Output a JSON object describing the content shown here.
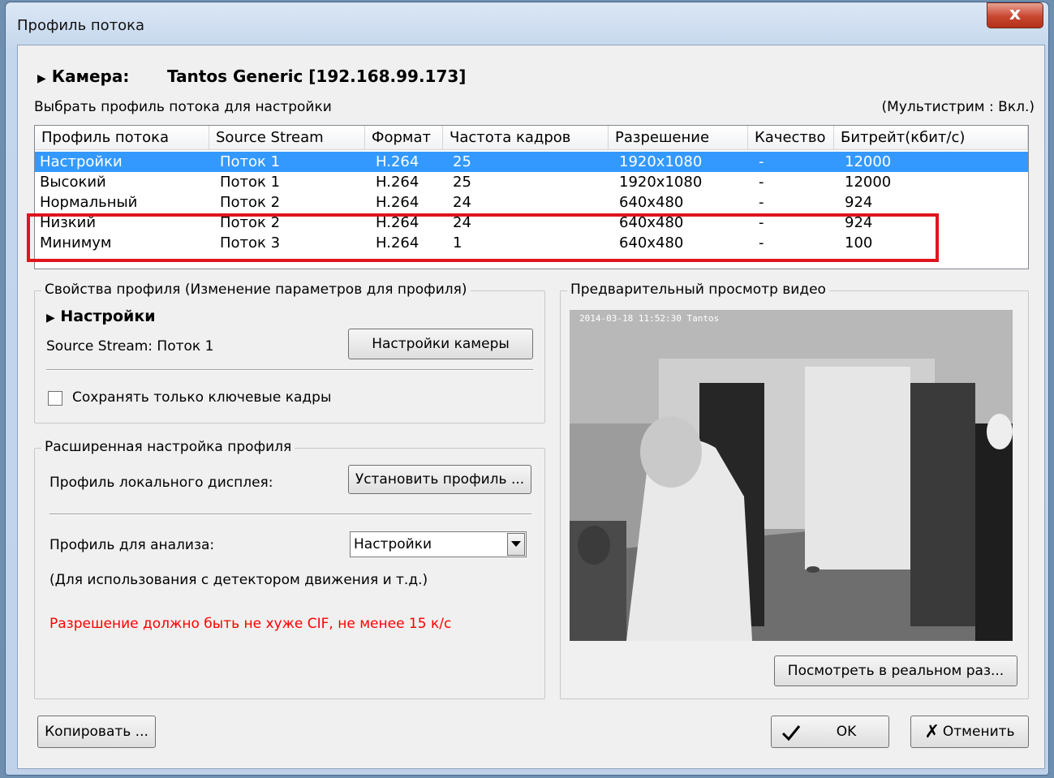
{
  "window": {
    "title": "Профиль потока",
    "close_glyph": "x"
  },
  "camera": {
    "label": "Камера:",
    "value": "Tantos Generic [192.168.99.173]"
  },
  "select_label": "Выбрать профиль потока для настройки",
  "multistream": "(Мультистрим : Вкл.)",
  "table": {
    "headers": [
      "Профиль потока",
      "Source Stream",
      "Формат",
      "Частота кадров",
      "Разрешение",
      "Качество",
      "Битрейт(кбит/с)"
    ],
    "rows": [
      [
        "Настройки",
        "Поток  1",
        "H.264",
        "25",
        "1920x1080",
        "-",
        "12000"
      ],
      [
        "Высокий",
        "Поток  1",
        "H.264",
        "25",
        "1920x1080",
        "-",
        "12000"
      ],
      [
        "Нормальный",
        "Поток  2",
        "H.264",
        "24",
        "640x480",
        "-",
        "924"
      ],
      [
        "Низкий",
        "Поток  2",
        "H.264",
        "24",
        "640x480",
        "-",
        "924"
      ],
      [
        "Минимум",
        "Поток  3",
        "H.264",
        "1",
        "640x480",
        "-",
        "100"
      ]
    ],
    "selected_index": 0
  },
  "props": {
    "title": "Свойства профиля (Изменение параметров для профиля)",
    "profile_name": "Настройки",
    "source_stream": "Source Stream: Поток  1",
    "camera_settings_button": "Настройки камеры",
    "keyframes_checkbox": "Сохранять только ключевые кадры",
    "keyframes_checked": false
  },
  "advanced": {
    "title": "Расширенная настройка профиля",
    "local_display_label": "Профиль локального дисплея:",
    "set_profile_button": "Установить профиль ...",
    "analysis_label": "Профиль для анализа:",
    "analysis_value": "Настройки",
    "analysis_note": "(Для использования с детектором движения и т.д.)",
    "warning": "Разрешение должно быть не хуже CIF, не менее 15 к/с",
    "warning_color": "#ff0000"
  },
  "preview": {
    "title": "Предварительный просмотр видео",
    "overlay_text": "2014-03-18 11:52:30 Tantos",
    "realsize_button": "Посмотреть в реальном раз..."
  },
  "buttons": {
    "copy": "Копировать ...",
    "ok": "OK",
    "cancel": "Отменить"
  },
  "colors": {
    "selection": "#3399ff",
    "highlight_box": "#e0141e"
  }
}
